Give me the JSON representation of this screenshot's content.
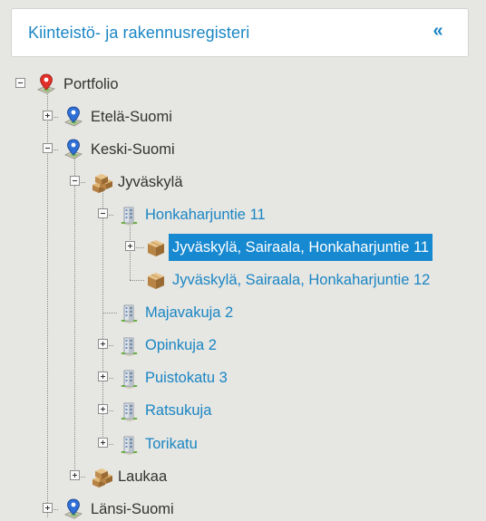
{
  "header": {
    "title": "Kiinteistö- ja rakennusregisteri",
    "collapse_glyph": "«"
  },
  "tree": {
    "portfolio": "Portfolio",
    "etela_suomi": "Etelä-Suomi",
    "keski_suomi": "Keski-Suomi",
    "jyvaskyla": "Jyväskylä",
    "honkaharjuntie_11": "Honkaharjuntie 11",
    "sairaala_11": "Jyväskylä, Sairaala, Honkaharjuntie 11",
    "sairaala_12": "Jyväskylä, Sairaala, Honkaharjuntie 12",
    "majavakuja_2": "Majavakuja 2",
    "opinkuja_2": "Opinkuja 2",
    "puistokatu_3": "Puistokatu 3",
    "ratsukuja": "Ratsukuja",
    "torikatu": "Torikatu",
    "laukaa": "Laukaa",
    "lansi_suomi": "Länsi-Suomi"
  },
  "icons": {
    "root": "red-map-pin-icon",
    "region": "blue-map-pin-icon",
    "city": "boxes-icon",
    "building": "building-icon",
    "unit": "box-icon"
  },
  "colors": {
    "accent": "#1a86c4",
    "selected_bg": "#1789d0",
    "background": "#e6e6e2"
  }
}
